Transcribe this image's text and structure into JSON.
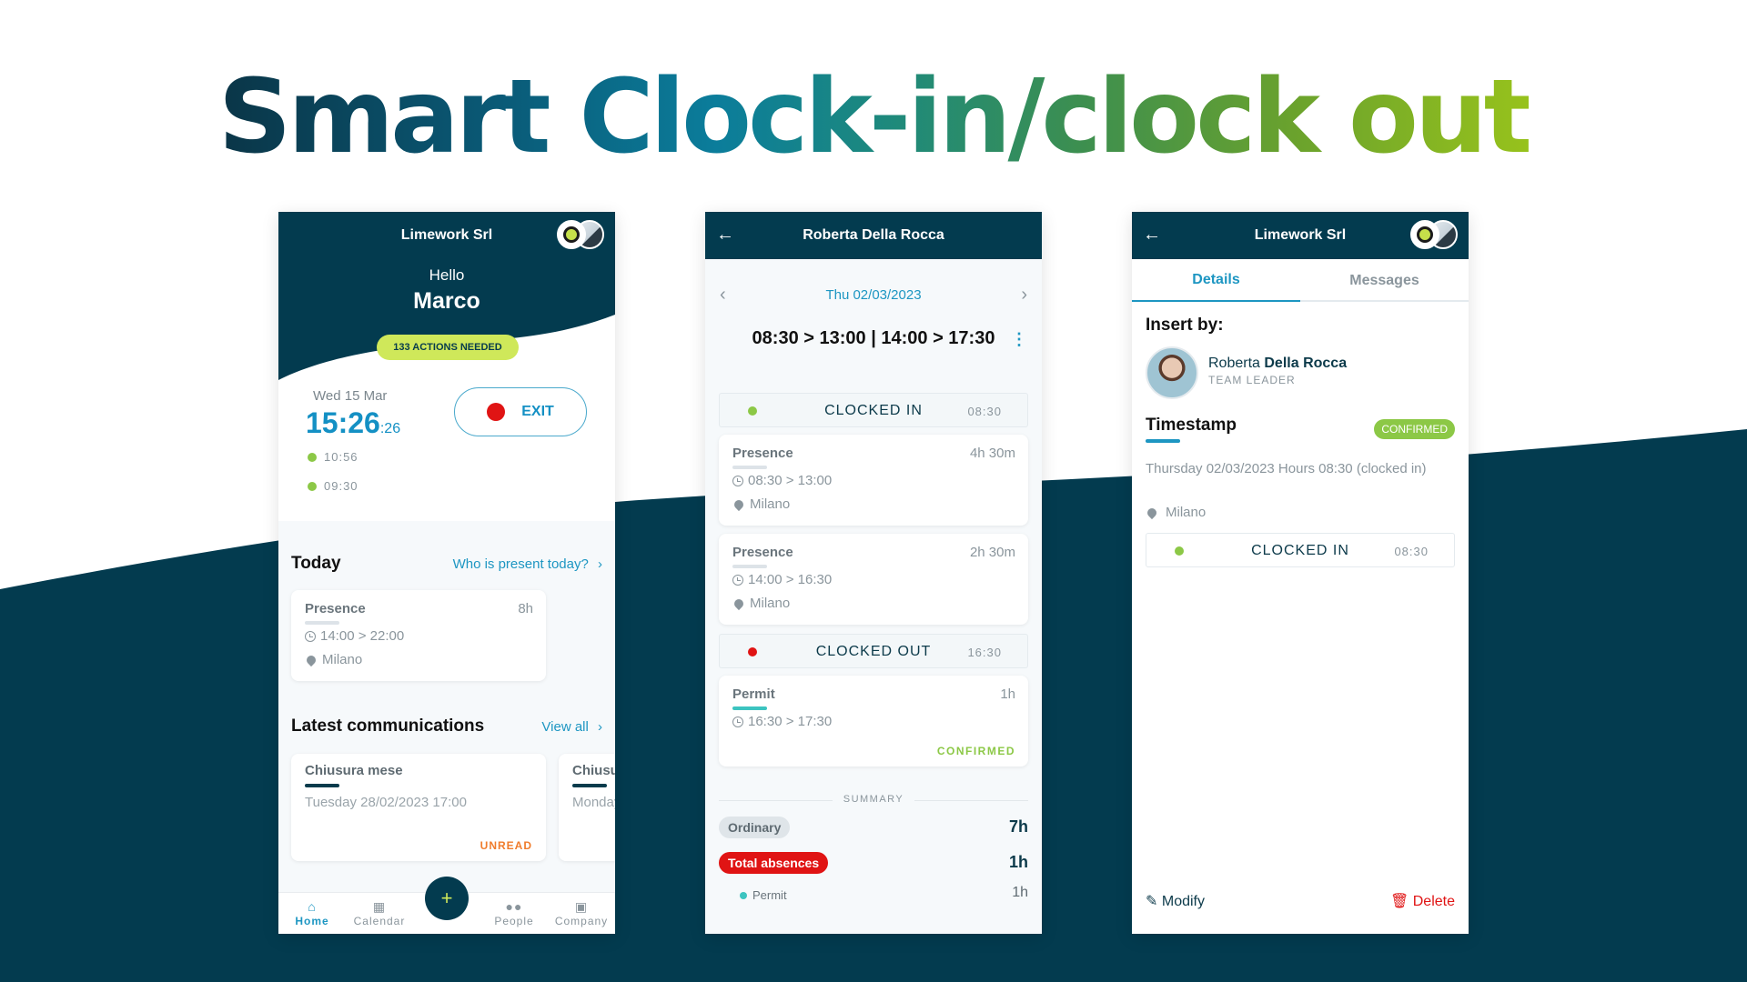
{
  "headline": "Smart Clock-in/clock out",
  "colors": {
    "primary_dark": "#033b4f",
    "accent_blue": "#1d96c2",
    "lime": "#cfe85a",
    "green": "#8cc846",
    "red": "#e01414",
    "teal": "#3cc4c0",
    "orange": "#f07c2c"
  },
  "home": {
    "company": "Limework Srl",
    "greeting": "Hello",
    "user_name": "Marco",
    "actions_needed": "133 ACTIONS NEEDED",
    "date": "Wed 15 Mar",
    "time_main": "15:26",
    "time_seconds": ":26",
    "exit_label": "EXIT",
    "punches": [
      "10:56",
      "09:30"
    ],
    "today": {
      "title": "Today",
      "link": "Who is present today?",
      "card": {
        "type": "Presence",
        "duration": "8h",
        "time": "14:00 > 22:00",
        "location": "Milano"
      }
    },
    "communications": {
      "title": "Latest communications",
      "link": "View all",
      "items": [
        {
          "title": "Chiusura mese",
          "date": "Tuesday 28/02/2023 17:00",
          "status": "UNREAD"
        },
        {
          "title": "Chiusura mese",
          "date": "Monday"
        }
      ]
    },
    "nav": [
      {
        "label": "Home",
        "icon": "home-icon",
        "active": true
      },
      {
        "label": "Calendar",
        "icon": "calendar-icon"
      },
      {
        "label": "+",
        "icon": "plus-icon"
      },
      {
        "label": "People",
        "icon": "people-icon"
      },
      {
        "label": "Company",
        "icon": "briefcase-icon"
      }
    ]
  },
  "day_detail": {
    "title": "Roberta Della Rocca",
    "date": "Thu 02/03/2023",
    "range": "08:30 > 13:00 | 14:00 > 17:30",
    "clock_in": {
      "label": "CLOCKED IN",
      "time": "08:30"
    },
    "entries": [
      {
        "type": "Presence",
        "duration": "4h 30m",
        "time": "08:30 > 13:00",
        "location": "Milano"
      },
      {
        "type": "Presence",
        "duration": "2h 30m",
        "time": "14:00 > 16:30",
        "location": "Milano"
      }
    ],
    "clock_out": {
      "label": "CLOCKED OUT",
      "time": "16:30"
    },
    "permit": {
      "type": "Permit",
      "duration": "1h",
      "time": "16:30 > 17:30",
      "status": "CONFIRMED"
    },
    "summary": {
      "label": "SUMMARY",
      "ordinary_label": "Ordinary",
      "ordinary_value": "7h",
      "absences_label": "Total absences",
      "absences_value": "1h",
      "permit_label": "Permit",
      "permit_value": "1h"
    }
  },
  "stamp_detail": {
    "company": "Limework Srl",
    "tabs": [
      "Details",
      "Messages"
    ],
    "insert_by_label": "Insert by:",
    "user_first": "Roberta",
    "user_last": "Della Rocca",
    "user_role": "TEAM LEADER",
    "timestamp_title": "Timestamp",
    "badge": "CONFIRMED",
    "description": "Thursday 02/03/2023 Hours 08:30 (clocked in)",
    "location": "Milano",
    "clock_in": {
      "label": "CLOCKED IN",
      "time": "08:30"
    },
    "modify_label": "Modify",
    "delete_label": "Delete"
  }
}
